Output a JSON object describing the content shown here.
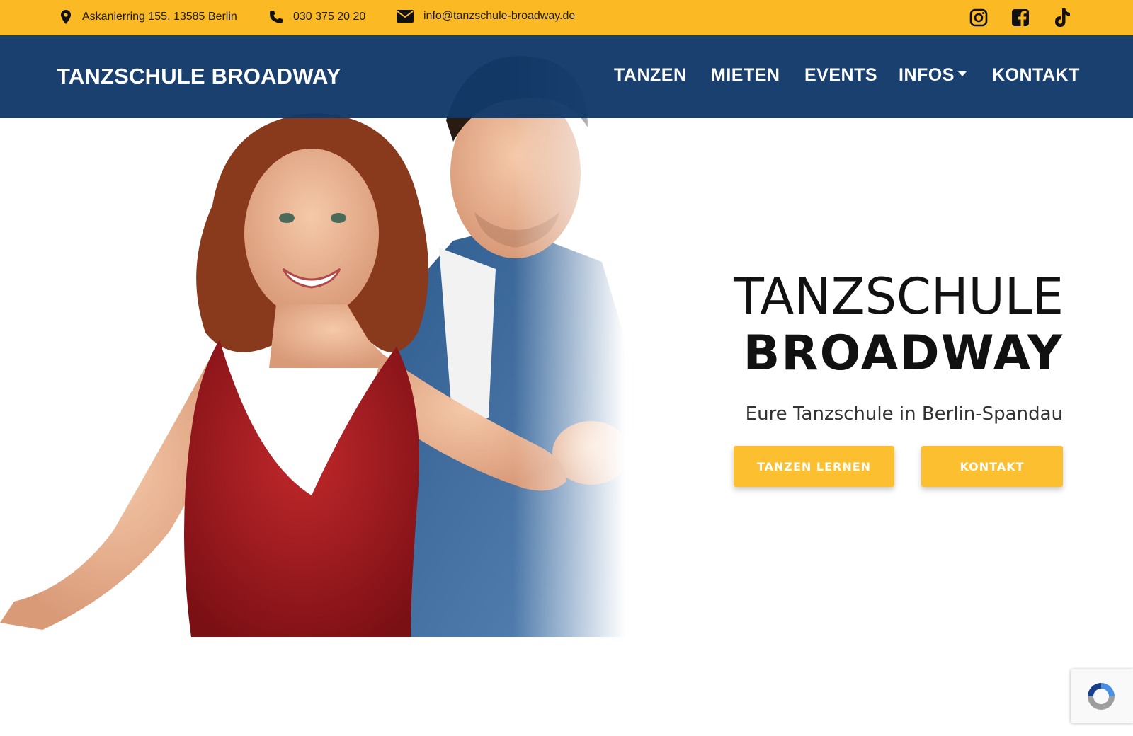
{
  "topbar": {
    "address": "Askanierring 155, 13585 Berlin",
    "phone": "030 375 20 20",
    "email": "info@tanzschule-broadway.de",
    "social": [
      "instagram-icon",
      "facebook-icon",
      "tiktok-icon"
    ]
  },
  "nav": {
    "brand": "TANZSCHULE BROADWAY",
    "items": [
      {
        "label": "TANZEN"
      },
      {
        "label": "MIETEN"
      },
      {
        "label": "EVENTS"
      },
      {
        "label": "INFOS",
        "has_dropdown": true
      },
      {
        "label": "KONTAKT"
      }
    ]
  },
  "hero": {
    "title_line1": "TANZSCHULE",
    "title_line2": "BROADWAY",
    "subtitle": "Eure Tanzschule in Berlin-Spandau",
    "buttons": [
      {
        "label": "TANZEN LERNEN"
      },
      {
        "label": "KONTAKT"
      }
    ],
    "image": "dancing-couple-photo"
  },
  "colors": {
    "accent_yellow": "#FBBA24",
    "nav_blue": "#123A69",
    "button_yellow": "#FBBF2F"
  }
}
